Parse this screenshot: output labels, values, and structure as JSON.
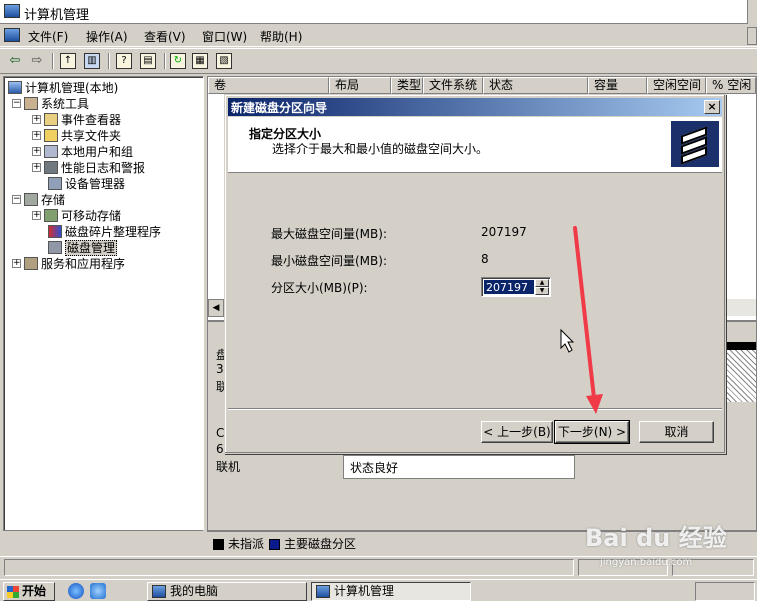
{
  "window": {
    "title": "计算机管理"
  },
  "menu": [
    "文件(F)",
    "操作(A)",
    "查看(V)",
    "窗口(W)",
    "帮助(H)"
  ],
  "tree": {
    "items": [
      {
        "label": "计算机管理(本地)",
        "level": 0,
        "expander": "-"
      },
      {
        "label": "系统工具",
        "level": 1,
        "expander": "-"
      },
      {
        "label": "事件查看器",
        "level": 2,
        "expander": "+"
      },
      {
        "label": "共享文件夹",
        "level": 2,
        "expander": "+"
      },
      {
        "label": "本地用户和组",
        "level": 2,
        "expander": "+"
      },
      {
        "label": "性能日志和警报",
        "level": 2,
        "expander": "+"
      },
      {
        "label": "设备管理器",
        "level": 2,
        "expander": ""
      },
      {
        "label": "存储",
        "level": 1,
        "expander": "-"
      },
      {
        "label": "可移动存储",
        "level": 2,
        "expander": "+"
      },
      {
        "label": "磁盘碎片整理程序",
        "level": 2,
        "expander": ""
      },
      {
        "label": "磁盘管理",
        "level": 2,
        "expander": "",
        "selected": true
      },
      {
        "label": "服务和应用程序",
        "level": 1,
        "expander": "+"
      }
    ]
  },
  "columns": [
    "卷",
    "布局",
    "类型",
    "文件系统",
    "状态",
    "容量",
    "空闲空间",
    "% 空闲"
  ],
  "lower": {
    "disk_label_frag": [
      "盘",
      "30",
      "联"
    ],
    "disk2_label_frag": [
      "C",
      "69"
    ],
    "online": "联机",
    "status_good": "状态良好"
  },
  "legend": {
    "unallocated": "未指派",
    "primary": "主要磁盘分区"
  },
  "dialog": {
    "title": "新建磁盘分区向导",
    "heading": "指定分区大小",
    "subheading": "选择介于最大和最小值的磁盘空间大小。",
    "max_label": "最大磁盘空间量(MB):",
    "max_value": "207197",
    "min_label": "最小磁盘空间量(MB):",
    "min_value": "8",
    "size_label": "分区大小(MB)(P):",
    "size_value": "207197",
    "back_button": "< 上一步(B)",
    "next_button": "下一步(N) >",
    "cancel_button": "取消"
  },
  "taskbar": {
    "start": "开始",
    "tasks": [
      "我的电脑",
      "计算机管理"
    ]
  },
  "watermark": {
    "brand": "Bai du 经验",
    "url": "jingyan.baidu.com"
  },
  "colors": {
    "dialog_title": "#0a246a",
    "annotation_arrow": "#f03a47",
    "unallocated": "#000000",
    "primary_partition": "#0a1a8a"
  }
}
